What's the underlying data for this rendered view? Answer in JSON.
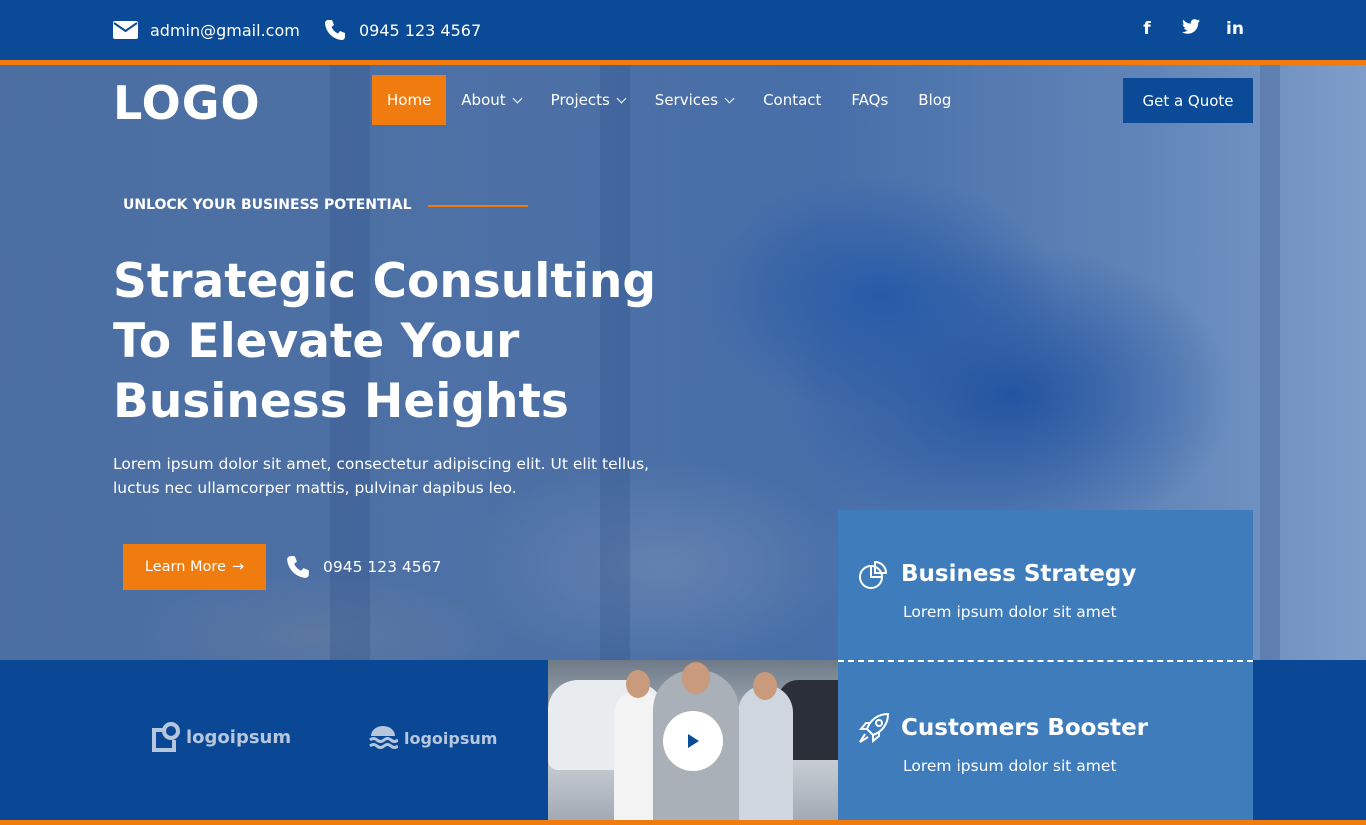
{
  "topbar": {
    "email": "admin@gmail.com",
    "phone": "0945 123 4567",
    "socials": {
      "facebook": "f",
      "twitter": "t",
      "linkedin": "in"
    }
  },
  "header": {
    "logo": "LOGO",
    "nav": [
      {
        "label": "Home",
        "active": true
      },
      {
        "label": "About",
        "dropdown": true
      },
      {
        "label": "Projects",
        "dropdown": true
      },
      {
        "label": "Services",
        "dropdown": true
      },
      {
        "label": "Contact"
      },
      {
        "label": "FAQs"
      },
      {
        "label": "Blog"
      }
    ],
    "cta": "Get a Quote"
  },
  "hero": {
    "tagline": "UNLOCK YOUR BUSINESS POTENTIAL",
    "headline_lines": [
      "Strategic Consulting",
      "To Elevate Your",
      "Business Heights"
    ],
    "description": "Lorem ipsum dolor sit amet, consectetur adipiscing elit. Ut elit tellus, luctus nec ullamcorper mattis, pulvinar dapibus leo.",
    "learn_more": "Learn More",
    "phone": "0945 123 4567"
  },
  "features": [
    {
      "title": "Business Strategy",
      "text": "Lorem ipsum dolor sit amet",
      "icon": "pie-chart-icon"
    },
    {
      "title": "Customers Booster",
      "text": "Lorem ipsum dolor sit amet",
      "icon": "rocket-icon"
    }
  ],
  "partners": [
    "logoipsum",
    "logoipsum"
  ],
  "colors": {
    "primary": "#0b4a96",
    "accent": "#f07c10",
    "card": "#3e7cbc"
  }
}
